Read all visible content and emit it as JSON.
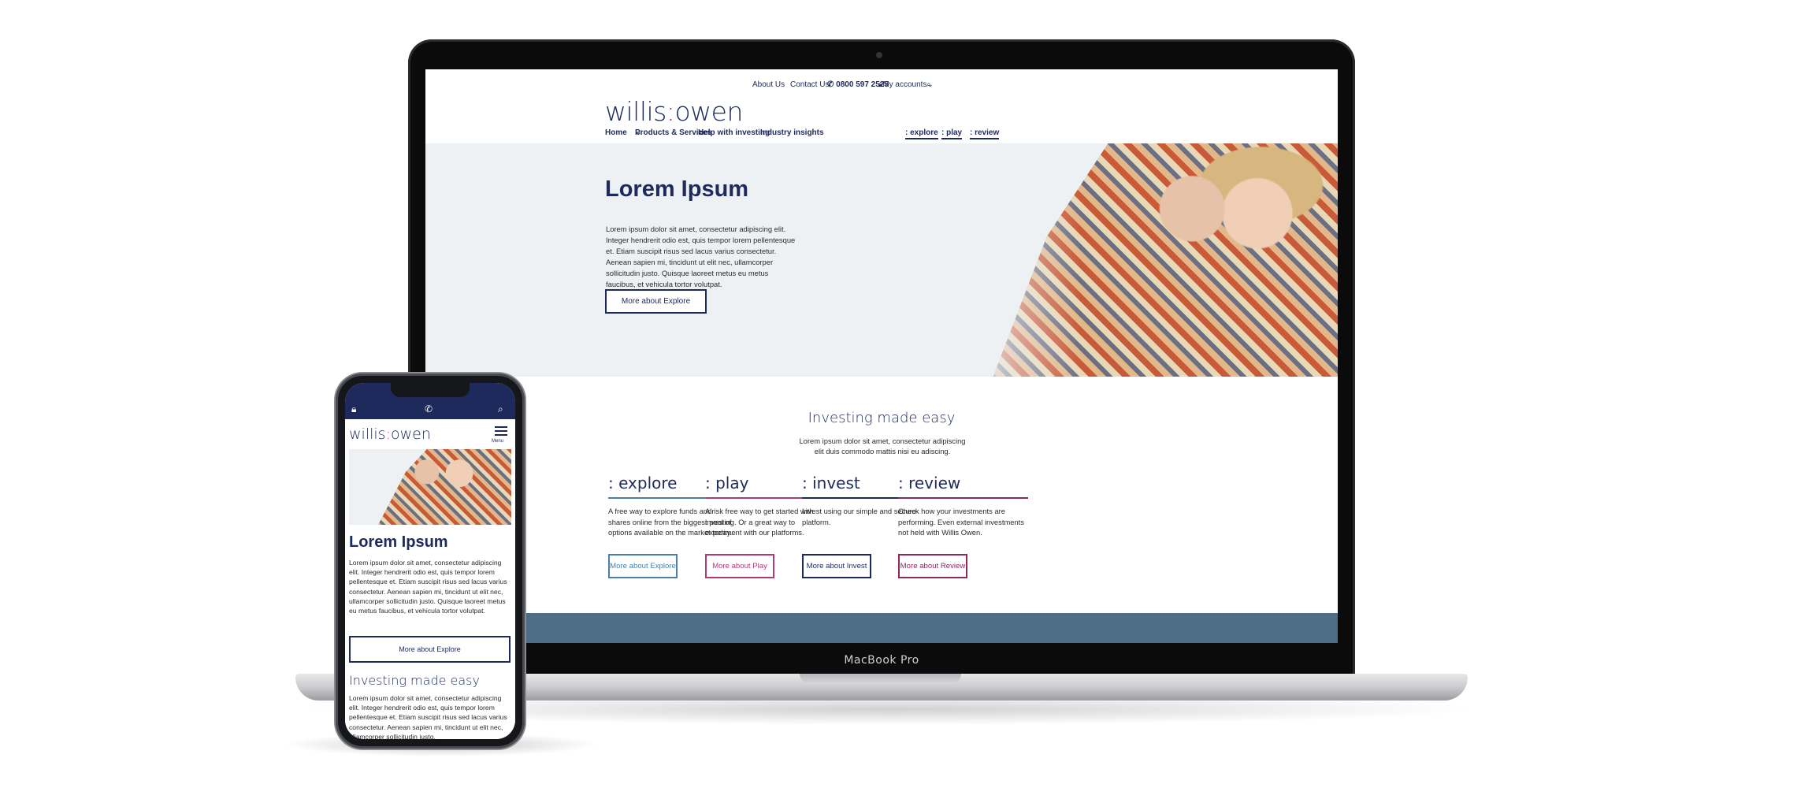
{
  "site": {
    "logo_left": "willis",
    "logo_colon": ":",
    "logo_right": "owen"
  },
  "utility_nav": {
    "about": "About Us",
    "contact": "Contact Us",
    "phone": "0800 597 2525",
    "accounts": "My accounts"
  },
  "main_nav": {
    "home": "Home",
    "products": "Products & Services",
    "help": "Help with investing",
    "insights": "Industry insights",
    "explore": ": explore",
    "play": ": play",
    "review": ": review"
  },
  "hero": {
    "title": "Lorem Ipsum",
    "text": "Lorem ipsum dolor sit amet, consectetur adipiscing elit. Integer hendrerit odio est, quis tempor lorem pellentesque et. Etiam suscipit risus sed lacus varius consectetur. Aenean sapien mi, tincidunt ut elit nec, ullamcorper sollicitudin justo. Quisque laoreet metus eu metus faucibus, et vehicula tortor volutpat.",
    "button": "More about Explore"
  },
  "section": {
    "title": "Investing made easy",
    "text": "Lorem ipsum dolor sit amet, consectetur adipiscing elit duis commodo mattis nisi eu adiscing."
  },
  "cards": [
    {
      "title": ": explore",
      "text": "A free way to explore funds and shares online from the biggest pool of options available on the market today.",
      "button": "More about Explore",
      "color": "#4a7fa8"
    },
    {
      "title": ": play",
      "text": "A risk free way to get started with investing. Or a great way to experiment with our platforms.",
      "button": "More about Play",
      "color": "#b23a72"
    },
    {
      "title": ": invest",
      "text": "Invest using our simple and secure platform.",
      "button": "More about Invest",
      "color": "#1d2a5b"
    },
    {
      "title": ": review",
      "text": "Check how your investments are performing. Even external investments not held with Willis Owen.",
      "button": "More about Review",
      "color": "#8c2a5c"
    }
  ],
  "laptop": {
    "label": "MacBook Pro"
  },
  "phone": {
    "menu_label": "Menu",
    "hero_title": "Lorem Ipsum",
    "hero_text": "Lorem ipsum dolor sit amet, consectetur adipiscing elit. Integer hendrerit odio est, quis tempor lorem pellentesque et. Etiam suscipit risus sed lacus varius consectetur. Aenean sapien mi, tincidunt ut elit nec, ullamcorper sollicitudin justo. Quisque laoreet metus eu metus faucibus, et vehicula tortor volutpat.",
    "hero_button": "More about Explore",
    "section_title": "Investing made easy",
    "section_text": "Lorem ipsum dolor sit amet, consectetur adipiscing elit. Integer hendrerit odio est, quis tempor lorem pellentesque et. Etiam suscipit risus sed lacus varius consectetur. Aenean sapien mi, tincidunt ut elit nec, ullamcorper sollicitudin justo."
  },
  "colors": {
    "brand_navy": "#1d2a5b",
    "brand_pink": "#e0007a",
    "band": "#4e6e88"
  },
  "icons": [
    "phone-icon",
    "lock-icon",
    "search-icon",
    "chevron-down-icon",
    "menu-icon"
  ]
}
